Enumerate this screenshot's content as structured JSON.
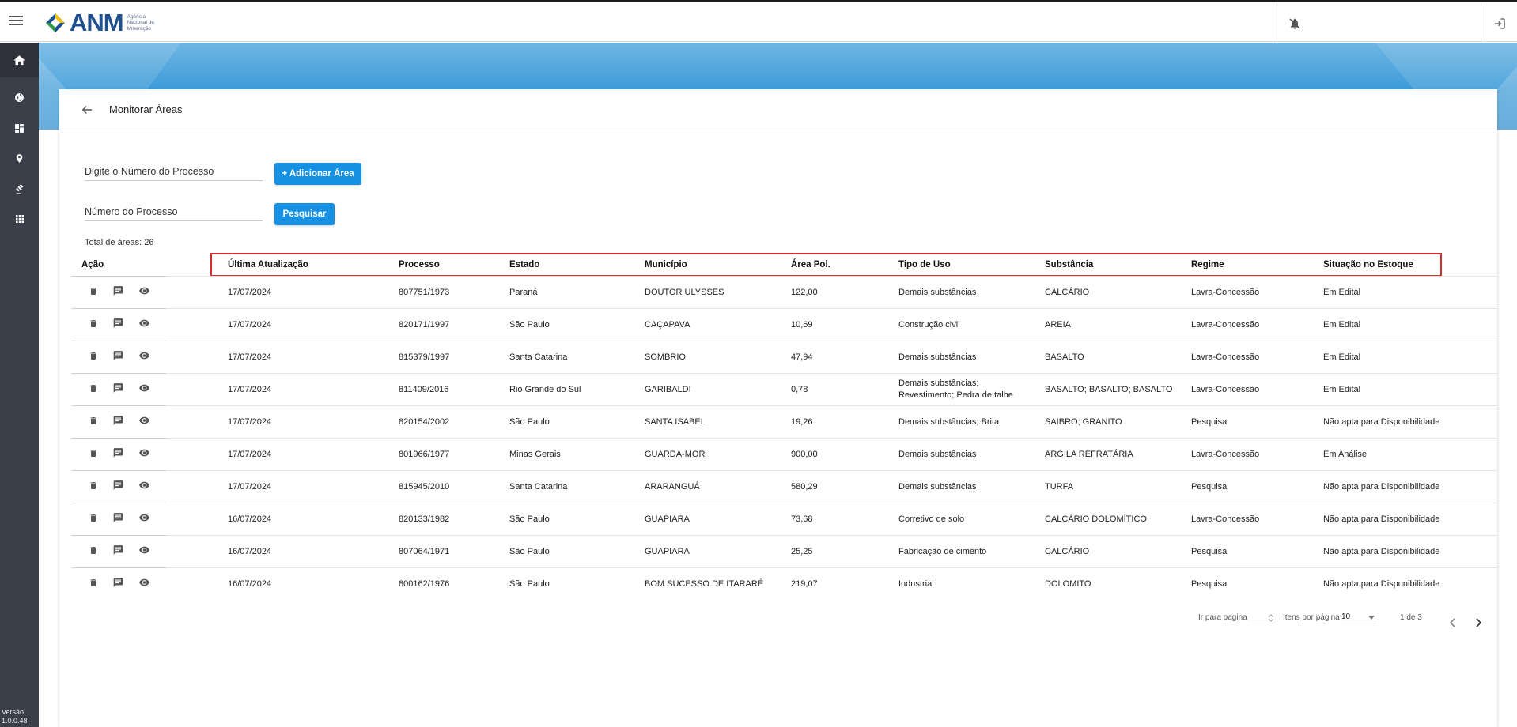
{
  "app": {
    "logo_text": "ANM",
    "logo_tagline": [
      "Agência",
      "Nacional de",
      "Mineração"
    ],
    "version_label": "Versão",
    "version_number": "1.0.0.48"
  },
  "icons": {
    "menu": "hamburger-icon",
    "notifications": "bell-off-icon",
    "logout": "logout-icon",
    "sidebar": [
      "home-icon",
      "globe-icon",
      "dashboard-icon",
      "location-pin-icon",
      "gavel-icon",
      "apps-grid-icon"
    ],
    "row_actions": [
      "trash-icon",
      "comment-icon",
      "eye-icon"
    ]
  },
  "colors": {
    "accent": "#1590e2",
    "sidebar": "#3b3f4a",
    "highlight": "#d32f2f"
  },
  "page": {
    "title": "Monitorar Áreas"
  },
  "form": {
    "add_placeholder": "Digite o Número do Processo",
    "add_button": "+ Adicionar Área",
    "search_placeholder": "Número do Processo",
    "search_button": "Pesquisar"
  },
  "table": {
    "total_label": "Total de áreas: 26",
    "headers": {
      "acao": "Ação",
      "atualizacao": "Última Atualização",
      "processo": "Processo",
      "estado": "Estado",
      "municipio": "Município",
      "area": "Área Pol.",
      "tipo": "Tipo de Uso",
      "substancia": "Substância",
      "regime": "Regime",
      "situacao": "Situação no Estoque"
    },
    "rows": [
      {
        "data": "17/07/2024",
        "processo": "807751/1973",
        "estado": "Paraná",
        "municipio": "DOUTOR ULYSSES",
        "area": "122,00",
        "tipo": "Demais substâncias",
        "tipo2": "",
        "substancia": "CALCÁRIO",
        "regime": "Lavra-Concessão",
        "situacao": "Em Edital"
      },
      {
        "data": "17/07/2024",
        "processo": "820171/1997",
        "estado": "São Paulo",
        "municipio": "CAÇAPAVA",
        "area": "10,69",
        "tipo": "Construção civil",
        "tipo2": "",
        "substancia": "AREIA",
        "regime": "Lavra-Concessão",
        "situacao": "Em Edital"
      },
      {
        "data": "17/07/2024",
        "processo": "815379/1997",
        "estado": "Santa Catarina",
        "municipio": "SOMBRIO",
        "area": "47,94",
        "tipo": "Demais substâncias",
        "tipo2": "",
        "substancia": "BASALTO",
        "regime": "Lavra-Concessão",
        "situacao": "Em Edital"
      },
      {
        "data": "17/07/2024",
        "processo": "811409/2016",
        "estado": "Rio Grande do Sul",
        "municipio": "GARIBALDI",
        "area": "0,78",
        "tipo": "Demais substâncias;",
        "tipo2": "Revestimento; Pedra de talhe",
        "substancia": "BASALTO; BASALTO; BASALTO",
        "regime": "Lavra-Concessão",
        "situacao": "Em Edital"
      },
      {
        "data": "17/07/2024",
        "processo": "820154/2002",
        "estado": "São Paulo",
        "municipio": "SANTA ISABEL",
        "area": "19,26",
        "tipo": "Demais substâncias; Brita",
        "tipo2": "",
        "substancia": "SAIBRO; GRANITO",
        "regime": "Pesquisa",
        "situacao": "Não apta para Disponibilidade"
      },
      {
        "data": "17/07/2024",
        "processo": "801966/1977",
        "estado": "Minas Gerais",
        "municipio": "GUARDA-MOR",
        "area": "900,00",
        "tipo": "Demais substâncias",
        "tipo2": "",
        "substancia": "ARGILA REFRATÁRIA",
        "regime": "Lavra-Concessão",
        "situacao": "Em Análise"
      },
      {
        "data": "17/07/2024",
        "processo": "815945/2010",
        "estado": "Santa Catarina",
        "municipio": "ARARANGUÁ",
        "area": "580,29",
        "tipo": "Demais substâncias",
        "tipo2": "",
        "substancia": "TURFA",
        "regime": "Pesquisa",
        "situacao": "Não apta para Disponibilidade"
      },
      {
        "data": "16/07/2024",
        "processo": "820133/1982",
        "estado": "São Paulo",
        "municipio": "GUAPIARA",
        "area": "73,68",
        "tipo": "Corretivo de solo",
        "tipo2": "",
        "substancia": "CALCÁRIO DOLOMÍTICO",
        "regime": "Lavra-Concessão",
        "situacao": "Não apta para Disponibilidade"
      },
      {
        "data": "16/07/2024",
        "processo": "807064/1971",
        "estado": "São Paulo",
        "municipio": "GUAPIARA",
        "area": "25,25",
        "tipo": "Fabricação de cimento",
        "tipo2": "",
        "substancia": "CALCÁRIO",
        "regime": "Pesquisa",
        "situacao": "Não apta para Disponibilidade"
      },
      {
        "data": "16/07/2024",
        "processo": "800162/1976",
        "estado": "São Paulo",
        "municipio": "BOM SUCESSO DE ITARARÉ",
        "area": "219,07",
        "tipo": "Industrial",
        "tipo2": "",
        "substancia": "DOLOMITO",
        "regime": "Pesquisa",
        "situacao": "Não apta para Disponibilidade"
      }
    ]
  },
  "pagination": {
    "go_to_label": "Ir para pagina",
    "per_page_label": "Itens por página",
    "per_page_value": "10",
    "range": "1 de 3"
  }
}
